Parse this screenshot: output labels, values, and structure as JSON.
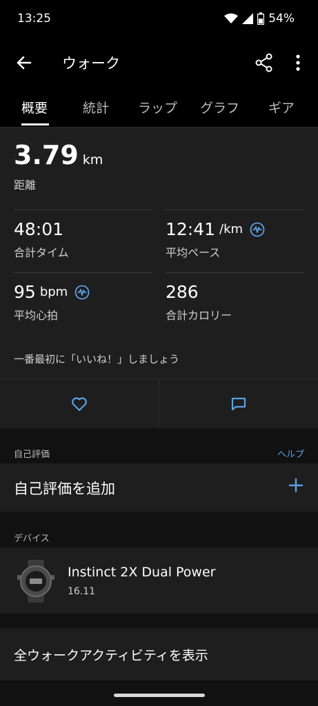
{
  "status_bar": {
    "time": "13:25",
    "battery": "54%"
  },
  "app_bar": {
    "title": "ウォーク"
  },
  "tabs": [
    {
      "label": "概要",
      "active": true
    },
    {
      "label": "統計"
    },
    {
      "label": "ラップ"
    },
    {
      "label": "グラフ"
    },
    {
      "label": "ギア"
    }
  ],
  "summary": {
    "distance": {
      "value": "3.79",
      "unit": "km",
      "label": "距離"
    },
    "total_time": {
      "value": "48:01",
      "label": "合計タイム"
    },
    "avg_pace": {
      "value": "12:41",
      "unit": "/km",
      "label": "平均ペース"
    },
    "avg_hr": {
      "value": "95",
      "unit": "bpm",
      "label": "平均心拍"
    },
    "calories": {
      "value": "286",
      "label": "合計カロリー"
    },
    "like_prompt": "一番最初に「いいね！」しましょう"
  },
  "self_eval": {
    "section": "自己評価",
    "help": "ヘルプ",
    "add": "自己評価を追加"
  },
  "device": {
    "section": "デバイス",
    "name": "Instinct 2X Dual Power",
    "version": "16.11"
  },
  "all_activities": "全ウォークアクティビティを表示",
  "colors": {
    "accent": "#5aa2e8",
    "background": "#111111",
    "card": "#1e1e1e"
  }
}
